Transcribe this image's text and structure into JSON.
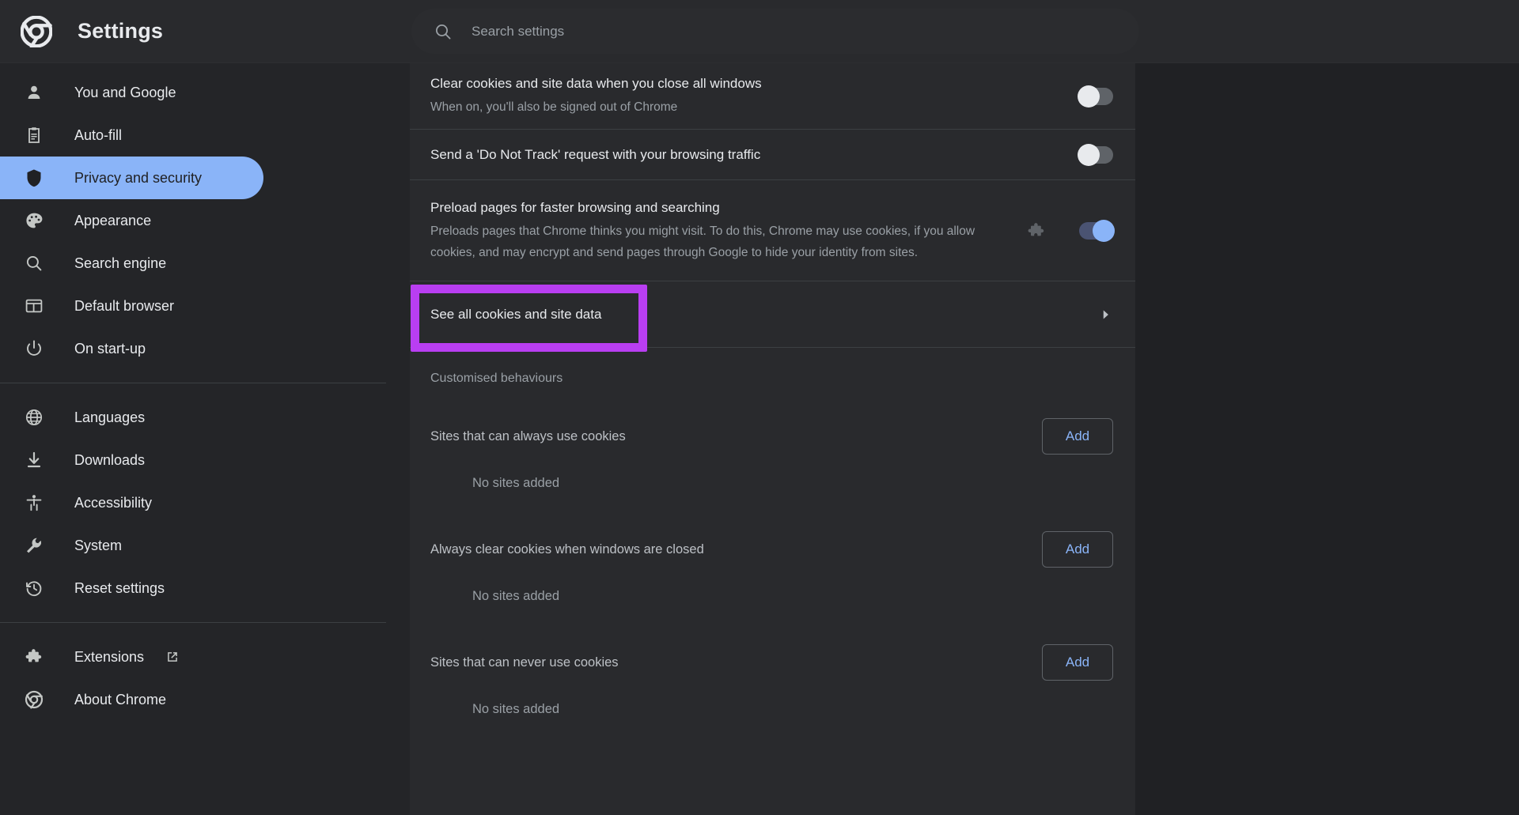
{
  "header": {
    "logo_icon": "chrome-logo-icon",
    "title": "Settings",
    "search": {
      "icon": "search-icon",
      "placeholder": "Search settings",
      "value": ""
    }
  },
  "sidebar": {
    "items": [
      {
        "icon": "person-icon",
        "label": "You and Google",
        "active": false
      },
      {
        "icon": "clipboard-icon",
        "label": "Auto-fill",
        "active": false
      },
      {
        "icon": "shield-icon",
        "label": "Privacy and security",
        "active": true
      },
      {
        "icon": "palette-icon",
        "label": "Appearance",
        "active": false
      },
      {
        "icon": "search-icon",
        "label": "Search engine",
        "active": false
      },
      {
        "icon": "browser-icon",
        "label": "Default browser",
        "active": false
      },
      {
        "icon": "power-icon",
        "label": "On start-up",
        "active": false
      }
    ],
    "items2": [
      {
        "icon": "globe-icon",
        "label": "Languages",
        "active": false
      },
      {
        "icon": "download-icon",
        "label": "Downloads",
        "active": false
      },
      {
        "icon": "accessibility-icon",
        "label": "Accessibility",
        "active": false
      },
      {
        "icon": "wrench-icon",
        "label": "System",
        "active": false
      },
      {
        "icon": "history-icon",
        "label": "Reset settings",
        "active": false
      }
    ],
    "items3": [
      {
        "icon": "puzzle-icon",
        "label": "Extensions",
        "external": true
      },
      {
        "icon": "chrome-logo-icon",
        "label": "About Chrome",
        "external": false
      }
    ],
    "active_color": "#8AB4F8"
  },
  "main": {
    "settings": [
      {
        "title": "Clear cookies and site data when you close all windows",
        "sub": "When on, you'll also be signed out of Chrome",
        "toggle": "off"
      },
      {
        "title": "Send a 'Do Not Track' request with your browsing traffic",
        "sub": "",
        "toggle": "off"
      },
      {
        "title": "Preload pages for faster browsing and searching",
        "sub": "Preloads pages that Chrome thinks you might visit. To do this, Chrome may use cookies, if you allow cookies, and may encrypt and send pages through Google to hide your identity from sites.",
        "toggle": "on",
        "policy_icon": "extension-puzzle-icon"
      }
    ],
    "see_all": {
      "label": "See all cookies and site data",
      "chevron": "chevron-right-icon",
      "highlight_color": "#B93EF2"
    },
    "customised_heading": "Customised behaviours",
    "groups": [
      {
        "label": "Sites that can always use cookies",
        "add_label": "Add",
        "empty": "No sites added"
      },
      {
        "label": "Always clear cookies when windows are closed",
        "add_label": "Add",
        "empty": "No sites added"
      },
      {
        "label": "Sites that can never use cookies",
        "add_label": "Add",
        "empty": "No sites added"
      }
    ]
  }
}
